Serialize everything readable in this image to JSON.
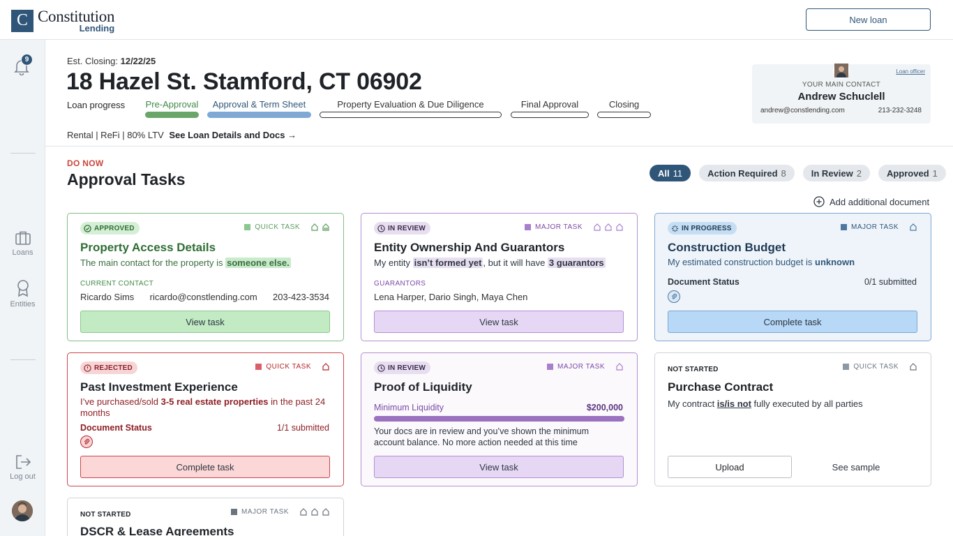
{
  "brand": {
    "logo_letter": "C",
    "name": "Constitution",
    "sub": "Lending"
  },
  "topbar": {
    "new_loan": "New loan"
  },
  "sidebar": {
    "notification_count": "9",
    "items": [
      {
        "label": "Loans",
        "icon": "briefcase-icon"
      },
      {
        "label": "Entities",
        "icon": "ribbon-icon"
      },
      {
        "label": "Log out",
        "icon": "logout-icon"
      }
    ]
  },
  "loan": {
    "est_label": "Est. Closing:",
    "est_date": "12/22/25",
    "address": "18 Hazel St. Stamford, CT 06902",
    "progress_label": "Loan progress",
    "stages": [
      {
        "label": "Pre-Approval",
        "status": "complete",
        "color": "#6aa56a"
      },
      {
        "label": "Approval & Term Sheet",
        "status": "current",
        "color": "#7fa9d4"
      },
      {
        "label": "Property Evaluation & Due Diligence",
        "status": "pending"
      },
      {
        "label": "Final Approval",
        "status": "pending"
      },
      {
        "label": "Closing",
        "status": "pending"
      }
    ],
    "meta": "Rental | ReFi | 80% LTV",
    "details_link": "See Loan Details and Docs →"
  },
  "contact": {
    "role_link": "Loan officer",
    "label": "YOUR MAIN CONTACT",
    "name": "Andrew Schuclell",
    "email": "andrew@constlending.com",
    "phone": "213-232-3248"
  },
  "tasks": {
    "kicker": "DO NOW",
    "title": "Approval Tasks",
    "filters": [
      {
        "label": "All",
        "count": "11",
        "active": true
      },
      {
        "label": "Action Required",
        "count": "8",
        "active": false
      },
      {
        "label": "In Review",
        "count": "2",
        "active": false
      },
      {
        "label": "Approved",
        "count": "1",
        "active": false
      }
    ],
    "add_doc": "Add additional document"
  },
  "cards": {
    "c1": {
      "status": "APPROVED",
      "type": "QUICK TASK",
      "title": "Property Access Details",
      "desc_pre": "The main contact for the property is ",
      "desc_hl": "someone else.",
      "sub_label": "CURRENT CONTACT",
      "contact_name": "Ricardo Sims",
      "contact_email": "ricardo@constlending.com",
      "contact_phone": "203-423-3534",
      "button": "View task"
    },
    "c2": {
      "status": "IN REVIEW",
      "type": "MAJOR TASK",
      "title": "Entity Ownership And Guarantors",
      "desc_pre": "My entity ",
      "desc_hl1": "isn’t formed yet",
      "desc_mid": ", but it will have ",
      "desc_hl2": "3 guarantors",
      "sub_label": "GUARANTORS",
      "guarantors": "Lena Harper, Dario Singh, Maya Chen",
      "button": "View task"
    },
    "c3": {
      "status": "IN PROGRESS",
      "type": "MAJOR TASK",
      "title": "Construction Budget",
      "desc_pre": "My estimated construction budget is ",
      "desc_b": "unknown",
      "doc_label": "Document Status",
      "doc_count": "0/1 submitted",
      "button": "Complete task"
    },
    "c4": {
      "status": "REJECTED",
      "type": "QUICK TASK",
      "title": "Past Investment Experience",
      "desc_pre": "I’ve purchased/sold ",
      "desc_b": "3-5 real estate properties",
      "desc_post": " in the past 24 months",
      "doc_label": "Document Status",
      "doc_count": "1/1 submitted",
      "button": "Complete task"
    },
    "c5": {
      "status": "IN REVIEW",
      "type": "MAJOR TASK",
      "title": "Proof of Liquidity",
      "liq_label": "Minimum Liquidity",
      "liq_value": "$200,000",
      "liq_progress": 1.0,
      "note": "Your docs are in review and you’ve shown the minimum account balance. No more action needed at this time",
      "button": "View task"
    },
    "c6": {
      "status": "NOT STARTED",
      "type": "QUICK TASK",
      "title": "Purchase Contract",
      "desc_pre": "My contract ",
      "desc_u": "is/is not",
      "desc_post": " fully executed by all parties",
      "upload": "Upload",
      "sample": "See sample"
    },
    "c7": {
      "status": "NOT STARTED",
      "type": "MAJOR TASK",
      "title": "DSCR & Lease Agreements"
    }
  },
  "colors": {
    "brand": "#2f5679",
    "approved": "#3f8a45",
    "review": "#7b4aa6",
    "progress": "#2f5679",
    "rejected": "#b3262d"
  }
}
